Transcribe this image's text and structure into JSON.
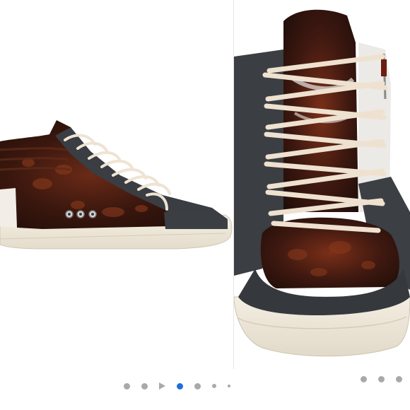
{
  "gallery": {
    "left_image": {
      "icon": "sneaker-side-view-image"
    },
    "right_image": {
      "icon": "sneaker-front-view-image"
    },
    "dots_left": [
      {
        "shape": "dot",
        "active": false
      },
      {
        "shape": "dot",
        "active": false
      },
      {
        "shape": "play",
        "active": false
      },
      {
        "shape": "dot",
        "active": true
      },
      {
        "shape": "dot",
        "active": false
      },
      {
        "shape": "small-dot",
        "active": false
      },
      {
        "shape": "tiny-dot",
        "active": false
      }
    ],
    "dots_right": [
      {
        "shape": "dot",
        "active": false
      },
      {
        "shape": "dot",
        "active": false
      },
      {
        "shape": "dot",
        "active": false
      }
    ],
    "colors": {
      "active_dot": "#1e6fd9",
      "inactive_dot": "#a9a9a9"
    }
  }
}
